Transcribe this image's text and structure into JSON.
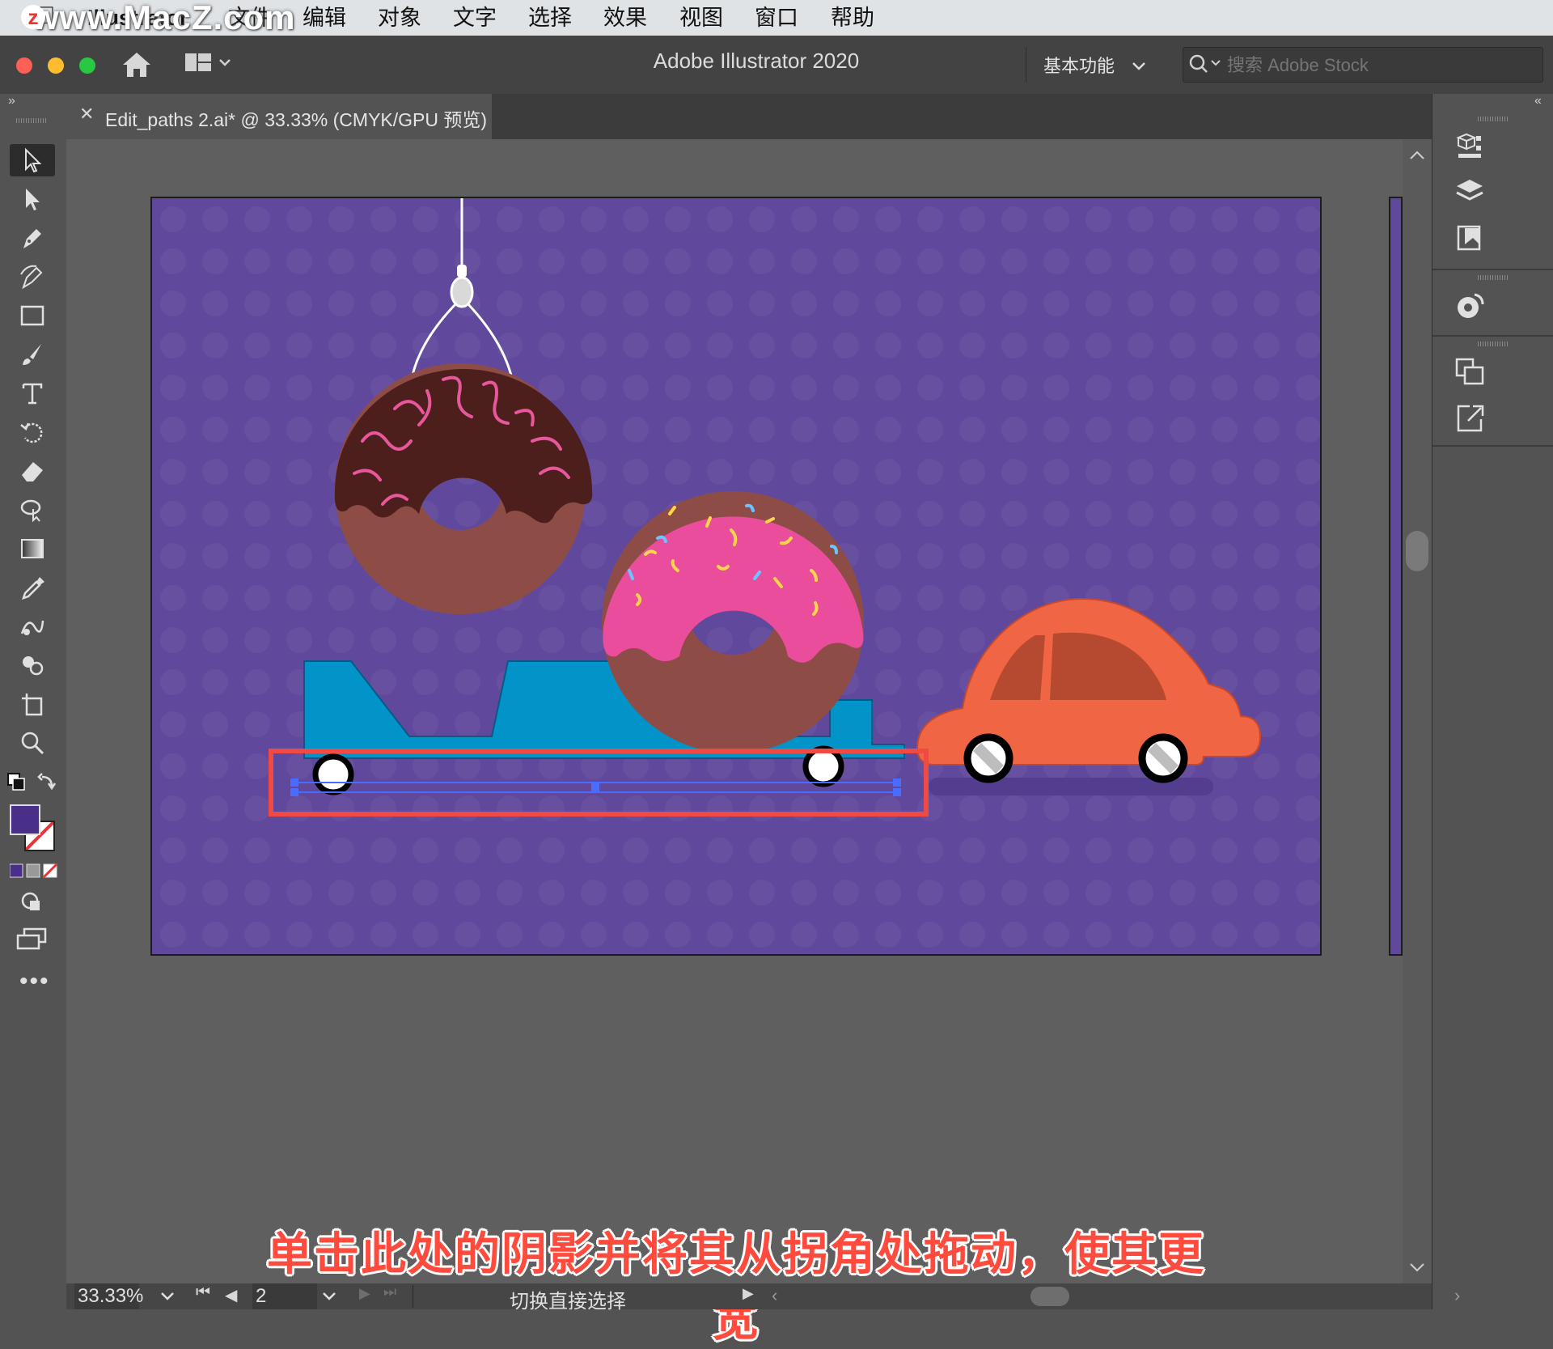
{
  "menubar": {
    "app_name": "Illustrator",
    "items": [
      "文件",
      "编辑",
      "对象",
      "文字",
      "选择",
      "效果",
      "视图",
      "窗口",
      "帮助"
    ],
    "watermark": "www.MacZ.com"
  },
  "appbar": {
    "title": "Adobe Illustrator 2020",
    "workspace": "基本功能",
    "search_placeholder": "搜索 Adobe Stock"
  },
  "document_tab": {
    "label": "Edit_paths 2.ai* @ 33.33% (CMYK/GPU 预览)"
  },
  "statusbar": {
    "zoom": "33.33%",
    "artboard_number": "2",
    "tool_hint": "切换直接选择"
  },
  "caption": "单击此处的阴影并将其从拐角处拖动，使其更宽",
  "colors": {
    "artboard": "#60499d",
    "highlight_box": "#f04a45",
    "selection": "#4a6bff",
    "car": "#f06543",
    "donut_pink": "#ea4d9c",
    "donut_choc": "#4c1f1c",
    "truck": "#0293c8"
  },
  "icons": {
    "tools": [
      "selection-tool-icon",
      "direct-selection-tool-icon",
      "pen-tool-icon",
      "curvature-tool-icon",
      "rectangle-tool-icon",
      "paintbrush-tool-icon",
      "type-tool-icon",
      "rotate-tool-icon",
      "eraser-tool-icon",
      "puppet-warp-tool-icon",
      "gradient-tool-icon",
      "eyedropper-tool-icon",
      "blend-tool-icon",
      "shape-builder-tool-icon",
      "artboard-tool-icon",
      "zoom-tool-icon"
    ],
    "panels": [
      "libraries-icon",
      "layers-icon",
      "properties-icon",
      "color-guide-icon",
      "artboards-icon",
      "export-icon"
    ]
  }
}
